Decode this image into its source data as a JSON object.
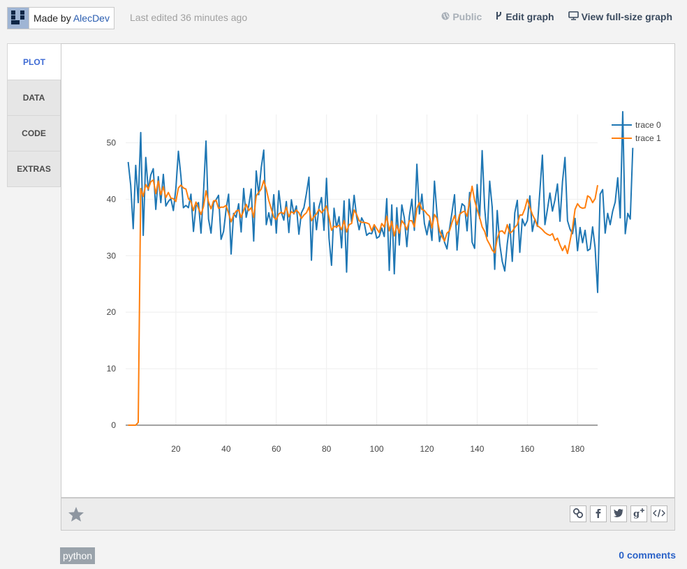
{
  "header": {
    "made_by_prefix": "Made by ",
    "author": "AlecDev",
    "last_edited": "Last edited 36 minutes ago",
    "public_label": "Public",
    "edit_label": "Edit graph",
    "view_full_label": "View full-size graph"
  },
  "tabs": [
    {
      "label": "PLOT",
      "active": true
    },
    {
      "label": "DATA",
      "active": false
    },
    {
      "label": "CODE",
      "active": false
    },
    {
      "label": "EXTRAS",
      "active": false
    }
  ],
  "footer": {
    "share_icons": [
      "link-icon",
      "facebook-icon",
      "twitter-icon",
      "google-plus-icon",
      "embed-code-icon"
    ],
    "tag": "python",
    "comments": "0 comments"
  },
  "colors": {
    "trace0": "#1f77b4",
    "trace1": "#ff7f0e",
    "link": "#2a62c8",
    "active_tab": "#3d6ad4"
  },
  "chart_data": {
    "type": "line",
    "title": "",
    "xlabel": "",
    "ylabel": "",
    "xlim": [
      0,
      188
    ],
    "ylim": [
      0,
      55
    ],
    "xticks": [
      20,
      40,
      60,
      80,
      100,
      120,
      140,
      160,
      180
    ],
    "yticks": [
      0,
      10,
      20,
      30,
      40,
      50
    ],
    "grid": true,
    "legend": "top-right",
    "series": [
      {
        "name": "trace 0",
        "x_start": 1,
        "values": [
          46.6,
          42.5,
          34.8,
          46.0,
          39.4,
          51.8,
          33.6,
          47.4,
          41.6,
          44.3,
          45.4,
          38.2,
          44.0,
          39.4,
          44.4,
          38.8,
          39.6,
          40.1,
          38.0,
          41.9,
          48.5,
          44.1,
          38.5,
          38.9,
          38.5,
          40.9,
          34.3,
          38.8,
          39.4,
          34.0,
          41.2,
          50.3,
          36.5,
          34.0,
          39.4,
          39.9,
          40.7,
          32.9,
          34.3,
          38.2,
          40.9,
          30.3,
          37.5,
          36.8,
          39.2,
          34.2,
          41.9,
          36.8,
          38.8,
          41.8,
          32.6,
          45.0,
          40.8,
          45.6,
          48.7,
          35.5,
          37.6,
          35.4,
          40.8,
          34.0,
          41.5,
          37.7,
          36.3,
          39.6,
          34.1,
          39.9,
          37.4,
          38.8,
          33.8,
          37.6,
          38.5,
          41.0,
          43.9,
          29.2,
          39.4,
          34.6,
          38.6,
          40.3,
          34.5,
          43.7,
          33.1,
          28.3,
          38.4,
          35.0,
          36.9,
          31.4,
          39.7,
          27.1,
          40.0,
          36.0,
          40.7,
          36.9,
          34.6,
          36.7,
          35.8,
          33.6,
          34.0,
          33.9,
          35.1,
          33.1,
          33.4,
          34.9,
          33.4,
          40.1,
          27.4,
          39.0,
          26.8,
          38.5,
          31.9,
          39.0,
          36.7,
          31.6,
          37.0,
          40.0,
          34.5,
          46.2,
          37.4,
          40.9,
          35.7,
          33.7,
          36.2,
          32.7,
          43.2,
          37.5,
          32.5,
          34.5,
          32.4,
          31.2,
          34.8,
          37.7,
          40.8,
          31.0,
          36.9,
          39.2,
          38.8,
          34.4,
          41.2,
          32.4,
          31.3,
          42.6,
          36.6,
          48.6,
          38.4,
          33.4,
          43.2,
          38.6,
          27.6,
          38.0,
          32.1,
          29.0,
          27.3,
          32.1,
          35.6,
          29.0,
          37.6,
          39.8,
          30.6,
          36.5,
          35.3,
          36.2,
          40.6,
          34.3,
          36.5,
          35.2,
          41.5,
          47.8,
          35.5,
          38.2,
          41.1,
          37.9,
          39.9,
          42.7,
          36.1,
          43.1,
          47.4,
          36.2,
          34.7,
          33.9,
          36.6,
          30.9,
          35.0,
          32.3,
          34.5,
          30.9,
          31.2,
          35.1,
          31.4,
          23.5,
          40.9,
          41.7,
          34.0,
          37.5,
          35.5,
          37.9,
          39.5,
          43.8,
          36.7,
          55.5,
          33.9,
          37.5,
          36.5,
          49.1
        ]
      },
      {
        "name": "trace 1",
        "x_start": 1,
        "values": [
          0,
          0,
          0,
          0,
          0.5,
          41.9,
          40.5,
          42.6,
          41.8,
          43.1,
          43.4,
          41.0,
          43.2,
          40.8,
          42.2,
          40.3,
          41.2,
          40.2,
          40.1,
          39.6,
          42.0,
          42.5,
          42.0,
          41.8,
          40.1,
          39.6,
          38.0,
          39.5,
          38.4,
          37.3,
          38.7,
          41.5,
          39.5,
          38.3,
          39.7,
          39.8,
          38.4,
          38.6,
          38.6,
          38.9,
          37.5,
          36.0,
          37.2,
          37.9,
          38.1,
          36.8,
          38.0,
          39.1,
          38.0,
          38.5,
          36.8,
          40.6,
          41.2,
          41.8,
          43.3,
          41.8,
          39.8,
          38.3,
          36.8,
          36.4,
          37.4,
          37.7,
          37.4,
          38.6,
          36.9,
          37.8,
          37.5,
          38.1,
          37.6,
          36.6,
          37.2,
          37.6,
          38.6,
          36.2,
          36.9,
          37.4,
          38.2,
          37.6,
          38.1,
          38.8,
          36.8,
          34.5,
          35.2,
          35.1,
          35.4,
          34.6,
          36.2,
          34.2,
          35.5,
          35.7,
          38.1,
          37.3,
          36.2,
          35.9,
          35.9,
          35.8,
          35.6,
          34.4,
          35.5,
          34.8,
          34.1,
          35.7,
          35.1,
          37.0,
          34.4,
          36.1,
          33.5,
          35.4,
          34.0,
          36.2,
          35.6,
          34.6,
          36.2,
          36.2,
          35.1,
          38.4,
          39.4,
          38.2,
          38.0,
          37.4,
          37.0,
          34.9,
          37.3,
          36.6,
          34.4,
          33.4,
          32.6,
          34.0,
          34.4,
          35.9,
          37.1,
          35.5,
          37.3,
          37.7,
          37.9,
          37.0,
          39.7,
          42.3,
          39.8,
          38.2,
          36.8,
          35.1,
          34.3,
          32.8,
          32.0,
          31.0,
          30.5,
          33.0,
          34.3,
          34.4,
          33.9,
          35.5,
          34.0,
          34.3,
          35.0,
          35.5,
          37.2,
          37.2,
          38.3,
          40.0,
          38.6,
          37.3,
          36.4,
          35.3,
          35.0,
          34.6,
          34.1,
          33.8,
          33.6,
          33.9,
          32.7,
          33.1,
          31.9,
          30.9,
          31.8,
          30.4,
          32.6,
          34.9,
          38.2,
          39.2,
          38.6,
          38.4,
          38.5,
          40.6,
          40.3,
          39.4,
          40.1,
          42.5
        ]
      }
    ]
  }
}
